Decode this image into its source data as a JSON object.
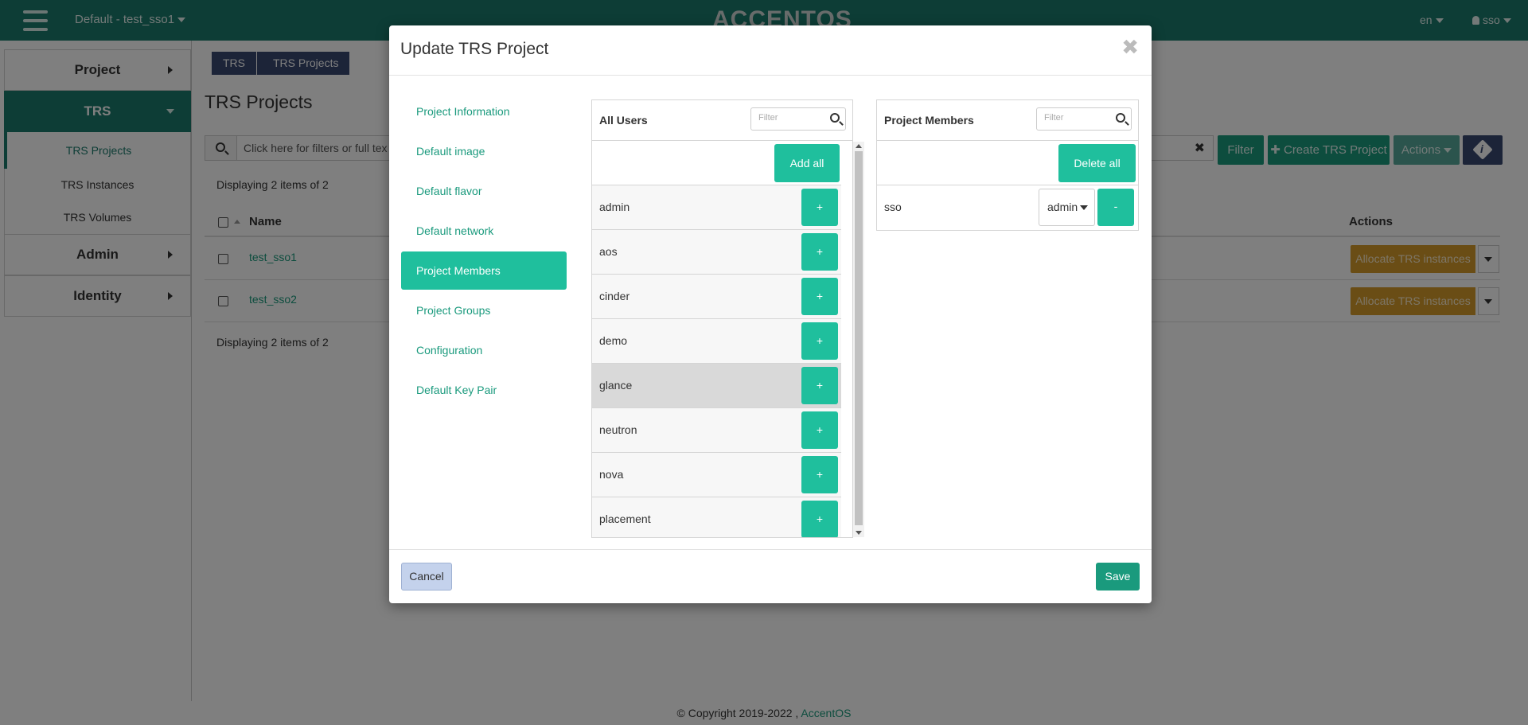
{
  "topbar": {
    "project_selector": "Default - test_sso1",
    "brand": "ACCENTOS",
    "language": "en",
    "user": "sso"
  },
  "sidebar": {
    "project": "Project",
    "trs": "TRS",
    "trs_items": [
      "TRS Projects",
      "TRS Instances",
      "TRS Volumes"
    ],
    "admin": "Admin",
    "identity": "Identity"
  },
  "breadcrumb": [
    "TRS",
    "TRS Projects"
  ],
  "page": {
    "title": "TRS Projects",
    "search_placeholder": "Click here for filters or full text search.",
    "search_visible": "Click here for filters or full tex",
    "clear": "✖",
    "filter_btn": "Filter",
    "create_btn": "Create TRS Project",
    "actions_btn": "Actions",
    "displaying": "Displaying 2 items of 2",
    "col_name": "Name",
    "col_actions": "Actions",
    "rows": [
      {
        "name": "test_sso1",
        "action": "Allocate TRS instances"
      },
      {
        "name": "test_sso2",
        "action": "Allocate TRS instances"
      }
    ]
  },
  "footer": {
    "copyright": "© Copyright 2019-2022 ,",
    "link": "AccentOS"
  },
  "modal": {
    "title": "Update TRS Project",
    "close": "✖",
    "steps": [
      "Project Information",
      "Default image",
      "Default flavor",
      "Default network",
      "Project Members",
      "Project Groups",
      "Configuration",
      "Default Key Pair"
    ],
    "active_step": "Project Members",
    "all_users": {
      "title": "All Users",
      "filter_placeholder": "Filter",
      "add_all": "Add all",
      "users": [
        "admin",
        "aos",
        "cinder",
        "demo",
        "glance",
        "neutron",
        "nova",
        "placement"
      ],
      "add_label": "+"
    },
    "members": {
      "title": "Project Members",
      "filter_placeholder": "Filter",
      "delete_all": "Delete all",
      "rows": [
        {
          "name": "sso",
          "role": "admin"
        }
      ],
      "remove_label": "-"
    },
    "cancel": "Cancel",
    "save": "Save"
  }
}
